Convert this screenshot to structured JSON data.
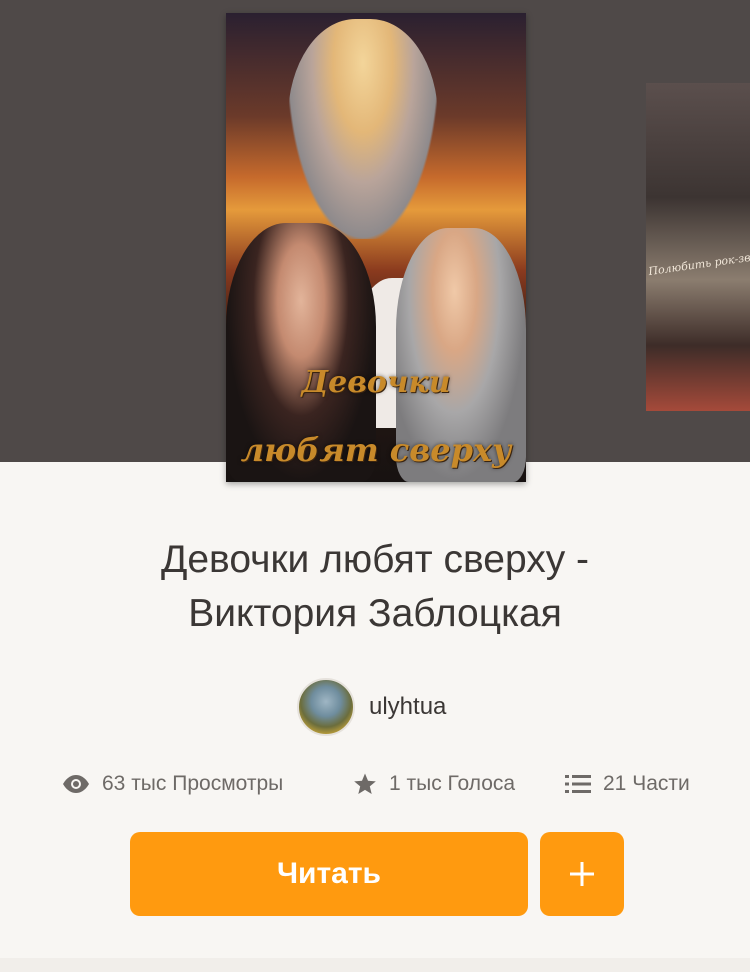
{
  "cover": {
    "title_line1": "Девочки",
    "title_line2": "любят сверху"
  },
  "next_cover": {
    "text": "Полюбить рок-зв"
  },
  "story": {
    "title_line1": "Девочки любят сверху -",
    "title_line2": "Виктория Заблоцкая"
  },
  "author": {
    "name": "ulyhtua"
  },
  "stats": {
    "views": "63 тыс Просмотры",
    "votes": "1 тыс Голоса",
    "parts": "21 Части"
  },
  "actions": {
    "read_label": "Читать",
    "add_label": "+"
  },
  "colors": {
    "accent": "#ff9a0f",
    "hero_bg": "#4f4948",
    "page_bg": "#f8f6f3"
  },
  "icons": {
    "views": "eye-icon",
    "votes": "star-icon",
    "parts": "list-icon",
    "add": "plus-icon"
  }
}
